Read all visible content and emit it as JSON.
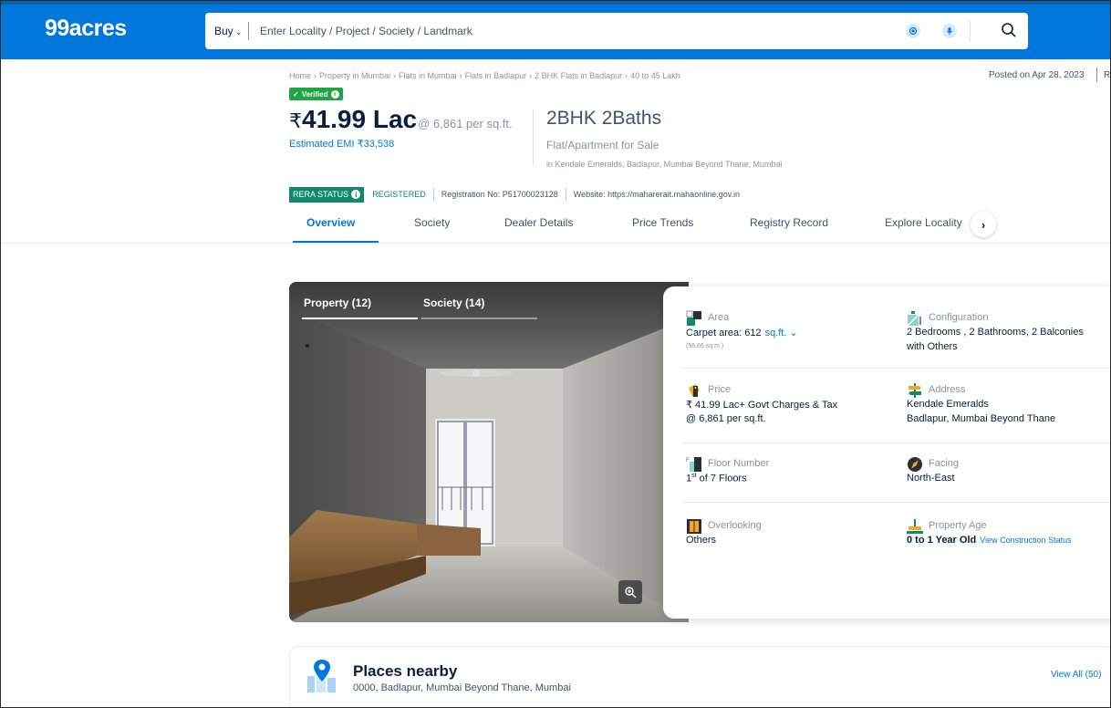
{
  "header": {
    "logo": "99acres",
    "buy_label": "Buy",
    "search_placeholder": "Enter Locality / Project / Society / Landmark",
    "icons": [
      "location-target-icon",
      "microphone-icon",
      "search-icon"
    ]
  },
  "breadcrumb": [
    "Home",
    "Property in Mumbai",
    "Flats in Mumbai",
    "Flats in Badlapur",
    "2 BHK Flats in Badlapur",
    "40 to 45 Lakh"
  ],
  "posted": "Posted on Apr 28, 2023",
  "posted_extra": "R",
  "verified_label": "Verified",
  "price": {
    "currency": "₹",
    "amount": "41.99 Lac",
    "per_sqft": "@ 6,861 per sq.ft.",
    "emi": "Estimated EMI ₹33,538"
  },
  "property": {
    "title": "2BHK 2Baths",
    "type": "Flat/Apartment for Sale",
    "location": "in Kendale Emeralds, Badlapur, Mumbai Beyond Thane, Mumbai"
  },
  "rera": {
    "label": "RERA STATUS",
    "status": "REGISTERED",
    "registration": "Registration No: P51700023128",
    "website": "Website: https://maharerait.mahaonline.gov.in"
  },
  "tabs": [
    "Overview",
    "Society",
    "Dealer Details",
    "Price Trends",
    "Registry Record",
    "Explore Locality"
  ],
  "active_tab": "Overview",
  "gallery": {
    "tabs": [
      "Property (12)",
      "Society (14)"
    ],
    "active": "Property (12)"
  },
  "details": {
    "area": {
      "label": "Area",
      "value": "Carpet area: 612",
      "unit": "sq.ft.",
      "sub": "(56.86 sq.m.)"
    },
    "configuration": {
      "label": "Configuration",
      "line1": "2 Bedrooms , 2 Bathrooms, 2 Balconies",
      "line2": "with Others"
    },
    "price": {
      "label": "Price",
      "line1": "₹ 41.99 Lac+ Govt Charges & Tax",
      "line2": "@ 6,861 per sq.ft."
    },
    "address": {
      "label": "Address",
      "line1": "Kendale Emeralds",
      "line2": "Badlapur, Mumbai Beyond Thane"
    },
    "floor": {
      "label": "Floor Number",
      "floor": "1",
      "suffix": "st",
      "rest": " of 7 Floors"
    },
    "facing": {
      "label": "Facing",
      "value": "North-East"
    },
    "overlooking": {
      "label": "Overlooking",
      "value": "Others"
    },
    "age": {
      "label": "Property Age",
      "value": "0 to 1 Year Old",
      "link": "View Construction Status"
    }
  },
  "places": {
    "title": "Places nearby",
    "address": "0000, Badlapur, Mumbai Beyond Thane, Mumbai",
    "view_all": "View All (50)"
  },
  "colors": {
    "brand_blue": "#0078db",
    "rera_green": "#0f8a6a",
    "verified_green": "#1fa644"
  }
}
